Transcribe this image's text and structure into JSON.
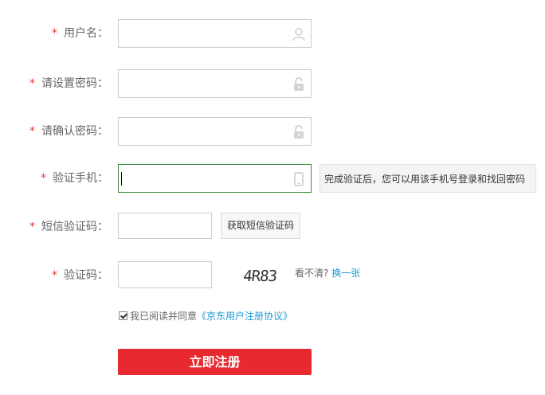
{
  "form": {
    "required_mark": "*",
    "username": {
      "label": "用户名：",
      "value": "",
      "icon": "user-icon"
    },
    "password": {
      "label": "请设置密码：",
      "value": "",
      "icon": "lock-icon"
    },
    "confirm_password": {
      "label": "请确认密码：",
      "value": "",
      "icon": "lock-icon"
    },
    "phone": {
      "label": "验证手机：",
      "value": "",
      "icon": "phone-icon",
      "hint": "完成验证后，您可以用该手机号登录和找回密码"
    },
    "sms_code": {
      "label": "短信验证码：",
      "value": "",
      "button": "获取短信验证码"
    },
    "captcha": {
      "label": "验证码：",
      "value": "",
      "image_text": "4R83",
      "tip": "看不清?",
      "refresh": "换一张"
    },
    "agreement": {
      "checked": true,
      "text": "我已阅读并同意",
      "link": "《京东用户注册协议》"
    },
    "submit_label": "立即注册"
  },
  "colors": {
    "accent": "#e4393c",
    "submit_bg": "#e8292f",
    "link": "#1a9bd6",
    "focus_border": "#3a8a3a"
  }
}
